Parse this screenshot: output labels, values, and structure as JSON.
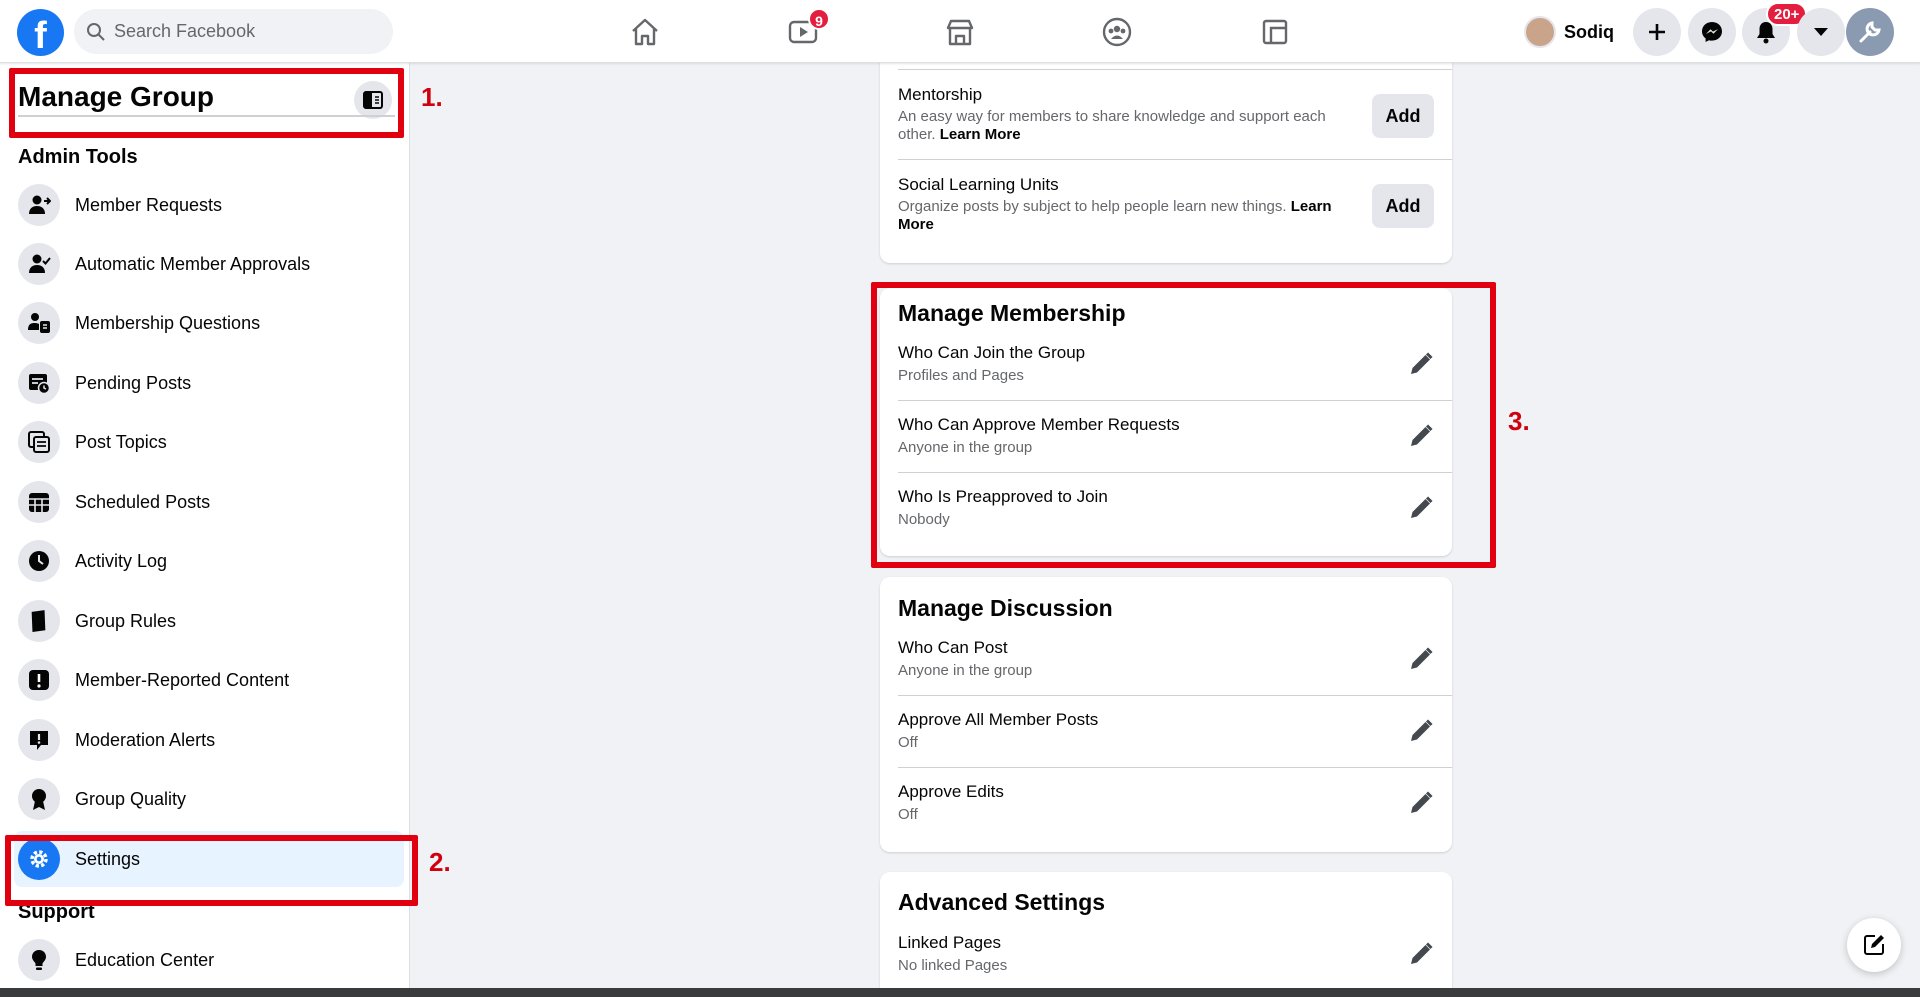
{
  "header": {
    "logo": "f",
    "search_placeholder": "Search Facebook",
    "video_badge": "9",
    "user_name": "Sodiq",
    "notifications_badge": "20+"
  },
  "sidebar": {
    "title": "Manage Group",
    "admin_tools_label": "Admin Tools",
    "items": [
      {
        "label": "Member Requests",
        "icon": "member-requests-icon"
      },
      {
        "label": "Automatic Member Approvals",
        "icon": "auto-approvals-icon"
      },
      {
        "label": "Membership Questions",
        "icon": "membership-questions-icon"
      },
      {
        "label": "Pending Posts",
        "icon": "pending-posts-icon"
      },
      {
        "label": "Post Topics",
        "icon": "post-topics-icon"
      },
      {
        "label": "Scheduled Posts",
        "icon": "scheduled-posts-icon"
      },
      {
        "label": "Activity Log",
        "icon": "clock-icon"
      },
      {
        "label": "Group Rules",
        "icon": "book-icon"
      },
      {
        "label": "Member-Reported Content",
        "icon": "report-icon"
      },
      {
        "label": "Moderation Alerts",
        "icon": "moderation-alert-icon"
      },
      {
        "label": "Group Quality",
        "icon": "badge-icon"
      },
      {
        "label": "Settings",
        "icon": "gear-icon",
        "active": true
      }
    ],
    "support_label": "Support",
    "support_items": [
      {
        "label": "Education Center",
        "icon": "lightbulb-icon"
      }
    ]
  },
  "annotations": {
    "one": "1.",
    "two": "2.",
    "three": "3."
  },
  "features": {
    "mentorship": {
      "title": "Mentorship",
      "desc": "An easy way for members to share knowledge and support each other.",
      "link": "Learn More",
      "button": "Add"
    },
    "social_learning": {
      "title": "Social Learning Units",
      "desc": "Organize posts by subject to help people learn new things.",
      "link": "Learn More",
      "button": "Add"
    }
  },
  "manage_membership": {
    "title": "Manage Membership",
    "rows": [
      {
        "title": "Who Can Join the Group",
        "value": "Profiles and Pages"
      },
      {
        "title": "Who Can Approve Member Requests",
        "value": "Anyone in the group"
      },
      {
        "title": "Who Is Preapproved to Join",
        "value": "Nobody"
      }
    ]
  },
  "manage_discussion": {
    "title": "Manage Discussion",
    "rows": [
      {
        "title": "Who Can Post",
        "value": "Anyone in the group"
      },
      {
        "title": "Approve All Member Posts",
        "value": "Off"
      },
      {
        "title": "Approve Edits",
        "value": "Off"
      }
    ]
  },
  "advanced_settings": {
    "title": "Advanced Settings",
    "rows": [
      {
        "title": "Linked Pages",
        "value": "No linked Pages"
      }
    ]
  },
  "colors": {
    "brand": "#1877f2",
    "annotation": "#e0000f",
    "badge": "#e41e3f"
  }
}
